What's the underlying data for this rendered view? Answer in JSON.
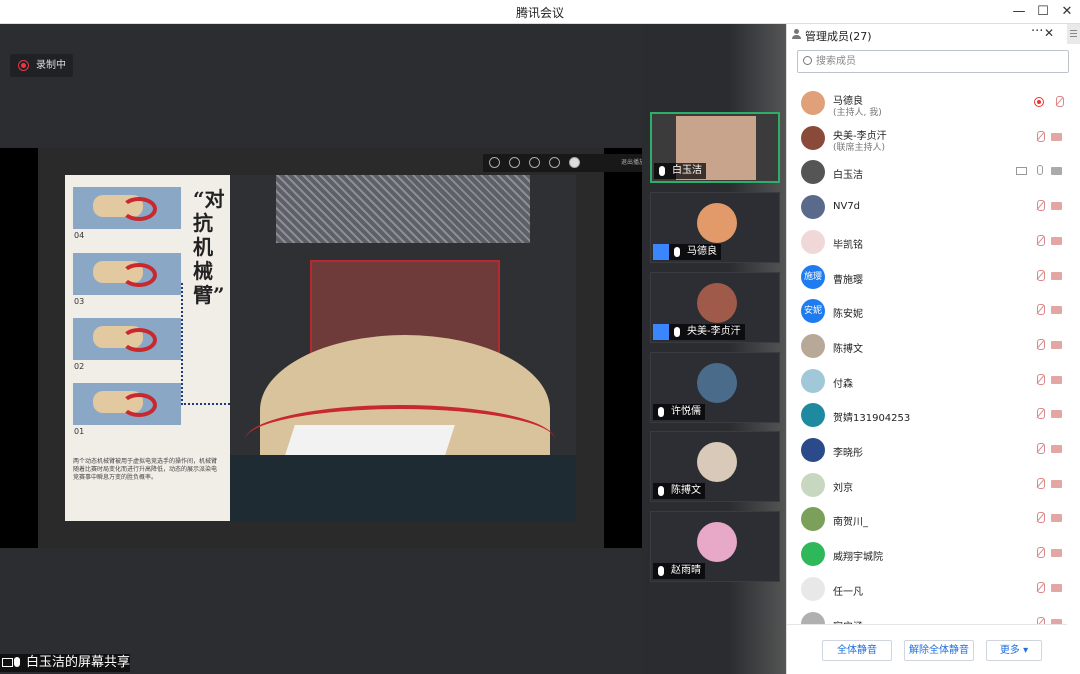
{
  "window": {
    "title": "腾讯会议",
    "minimize": "—",
    "maximize": "☐",
    "close": "✕"
  },
  "recording": {
    "label": "录制中"
  },
  "slide": {
    "title": "“对抗机械臂”",
    "thumbs": [
      "04",
      "03",
      "02",
      "01"
    ],
    "description": "两个动态机械臂被用于虚拟电竞选手的操作间，机械臂随着比赛时局变化而进行升高降低，动态的展示派染电竞赛事中瞬息万变的胜负概率。",
    "toolbar_exit": "退出播放"
  },
  "share_label": "白玉洁的屏幕共享",
  "video_tiles": [
    {
      "name": "白玉洁",
      "avatar_color": "#c9a48c"
    },
    {
      "name": "马德良",
      "avatar_color": "#e39a6b"
    },
    {
      "name": "央美-李贞汗",
      "avatar_color": "#a05a4a"
    },
    {
      "name": "许悦儒",
      "avatar_color": "#4a6b8a"
    },
    {
      "name": "陈搏文",
      "avatar_color": "#d8c9b8"
    },
    {
      "name": "赵雨晴",
      "avatar_color": "#e8a8c8"
    }
  ],
  "sidebar": {
    "title": "管理成员(27)",
    "more": "···",
    "close": "✕",
    "search_placeholder": "搜索成员",
    "members": [
      {
        "name": "马德良",
        "sub": "(主持人, 我)",
        "avatar": "",
        "color": "#e0a07a",
        "status": "rec"
      },
      {
        "name": "央美-李贞汗",
        "sub": "(联席主持人)",
        "avatar": "",
        "color": "#8a4a3a",
        "status": "muted"
      },
      {
        "name": "白玉洁",
        "sub": "",
        "avatar": "",
        "color": "#555",
        "status": "sharing"
      },
      {
        "name": "NV7d",
        "sub": "",
        "avatar": "",
        "color": "#5a6a8a",
        "status": "muted"
      },
      {
        "name": "毕凯铭",
        "sub": "",
        "avatar": "",
        "color": "#f0d8d8",
        "status": "muted"
      },
      {
        "name": "曹施璎",
        "sub": "",
        "avatar": "施璎",
        "color": "#1e7cf0",
        "status": "muted"
      },
      {
        "name": "陈安妮",
        "sub": "",
        "avatar": "安妮",
        "color": "#1e7cf0",
        "status": "muted"
      },
      {
        "name": "陈搏文",
        "sub": "",
        "avatar": "",
        "color": "#b8a898",
        "status": "muted"
      },
      {
        "name": "付森",
        "sub": "",
        "avatar": "",
        "color": "#a0c8d8",
        "status": "muted"
      },
      {
        "name": "贺婧131904253",
        "sub": "",
        "avatar": "",
        "color": "#1e8aa0",
        "status": "muted"
      },
      {
        "name": "李晓彤",
        "sub": "",
        "avatar": "",
        "color": "#2a4a8a",
        "status": "muted"
      },
      {
        "name": "刘京",
        "sub": "",
        "avatar": "",
        "color": "#c8d8c0",
        "status": "muted"
      },
      {
        "name": "南贺川_",
        "sub": "",
        "avatar": "",
        "color": "#7aa05a",
        "status": "muted"
      },
      {
        "name": "威翔宇城院",
        "sub": "",
        "avatar": "",
        "color": "#2eb85a",
        "status": "muted"
      },
      {
        "name": "任一凡",
        "sub": "",
        "avatar": "",
        "color": "#e8e8e8",
        "status": "muted"
      },
      {
        "name": "宿宁涵",
        "sub": "",
        "avatar": "",
        "color": "#b0b0b0",
        "status": "muted"
      }
    ],
    "footer": {
      "mute_all": "全体静音",
      "unmute_all": "解除全体静音",
      "more": "更多 ▾"
    }
  }
}
